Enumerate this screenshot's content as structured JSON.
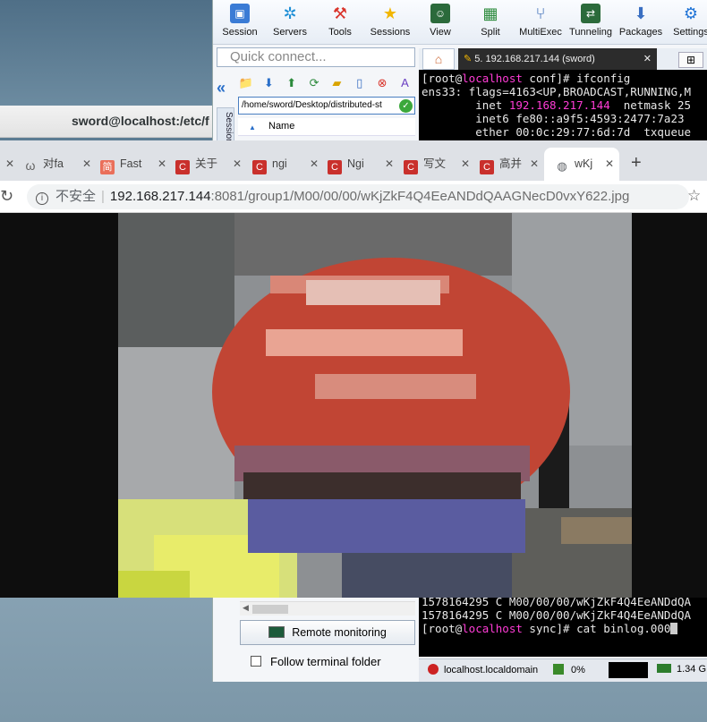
{
  "background_window": {
    "title": "sword@localhost:/etc/f"
  },
  "mobaxterm": {
    "toolbar": [
      {
        "label": "Session",
        "icon": "session-icon"
      },
      {
        "label": "Servers",
        "icon": "servers-icon"
      },
      {
        "label": "Tools",
        "icon": "tools-icon"
      },
      {
        "label": "Sessions",
        "icon": "star-icon"
      },
      {
        "label": "View",
        "icon": "view-icon"
      },
      {
        "label": "Split",
        "icon": "split-icon"
      },
      {
        "label": "MultiExec",
        "icon": "multiexec-icon"
      },
      {
        "label": "Tunneling",
        "icon": "tunneling-icon"
      },
      {
        "label": "Packages",
        "icon": "packages-icon"
      },
      {
        "label": "Settings",
        "icon": "gear-icon"
      }
    ],
    "quick_connect_placeholder": "Quick connect...",
    "sessions_tab": "Sessions",
    "sftp_path": "/home/sword/Desktop/distributed-st",
    "file_column": "Name",
    "terminal_tab": "5. 192.168.217.144 (sword)",
    "terminal_top": {
      "line1_prompt_user": "[root@",
      "line1_host": "localhost",
      "line1_rest": " conf]# ifconfig",
      "line2": "ens33: flags=4163<UP,BROADCAST,RUNNING,M",
      "line3_pre": "        inet ",
      "line3_ip": "192.168.217.144",
      "line3_post": "  netmask 25",
      "line4": "        inet6 fe80::a9f5:4593:2477:7a23",
      "line5": "        ether 00:0c:29:77:6d:7d  txqueue"
    },
    "terminal_bottom": {
      "line1": "1578164295 C M00/00/00/wKjZkF4Q4EeANDdQA",
      "line2": "1578164295 C M00/00/00/wKjZkF4Q4EeANDdQA",
      "line3_pre": "[root@",
      "line3_host": "localhost",
      "line3_post": " sync]# cat binlog.000"
    },
    "remote_monitoring": "Remote monitoring",
    "follow_terminal_folder": "Follow terminal folder",
    "status": {
      "host": "localhost.localdomain",
      "cpu": "0%",
      "memory": "1.34 G"
    }
  },
  "chrome": {
    "tabs": [
      {
        "label": "",
        "fav": ""
      },
      {
        "label": "对fa",
        "fav": "ω",
        "fav_color": "#666666"
      },
      {
        "label": "Fast",
        "fav": "简",
        "fav_color": "#ea6f5a"
      },
      {
        "label": "关于",
        "fav": "C",
        "fav_color": "#c9302c"
      },
      {
        "label": "ngi",
        "fav": "C",
        "fav_color": "#c9302c"
      },
      {
        "label": "Ngi",
        "fav": "C",
        "fav_color": "#c9302c"
      },
      {
        "label": "写文",
        "fav": "C",
        "fav_color": "#c9302c"
      },
      {
        "label": "高并",
        "fav": "C",
        "fav_color": "#c9302c"
      }
    ],
    "active_tab": "wKj",
    "address": {
      "insecure": "不安全",
      "host": "192.168.217.144",
      "rest": ":8081/group1/M00/00/00/wKjZkF4Q4EeANDdQAAGNecD0vxY622.jpg"
    }
  }
}
